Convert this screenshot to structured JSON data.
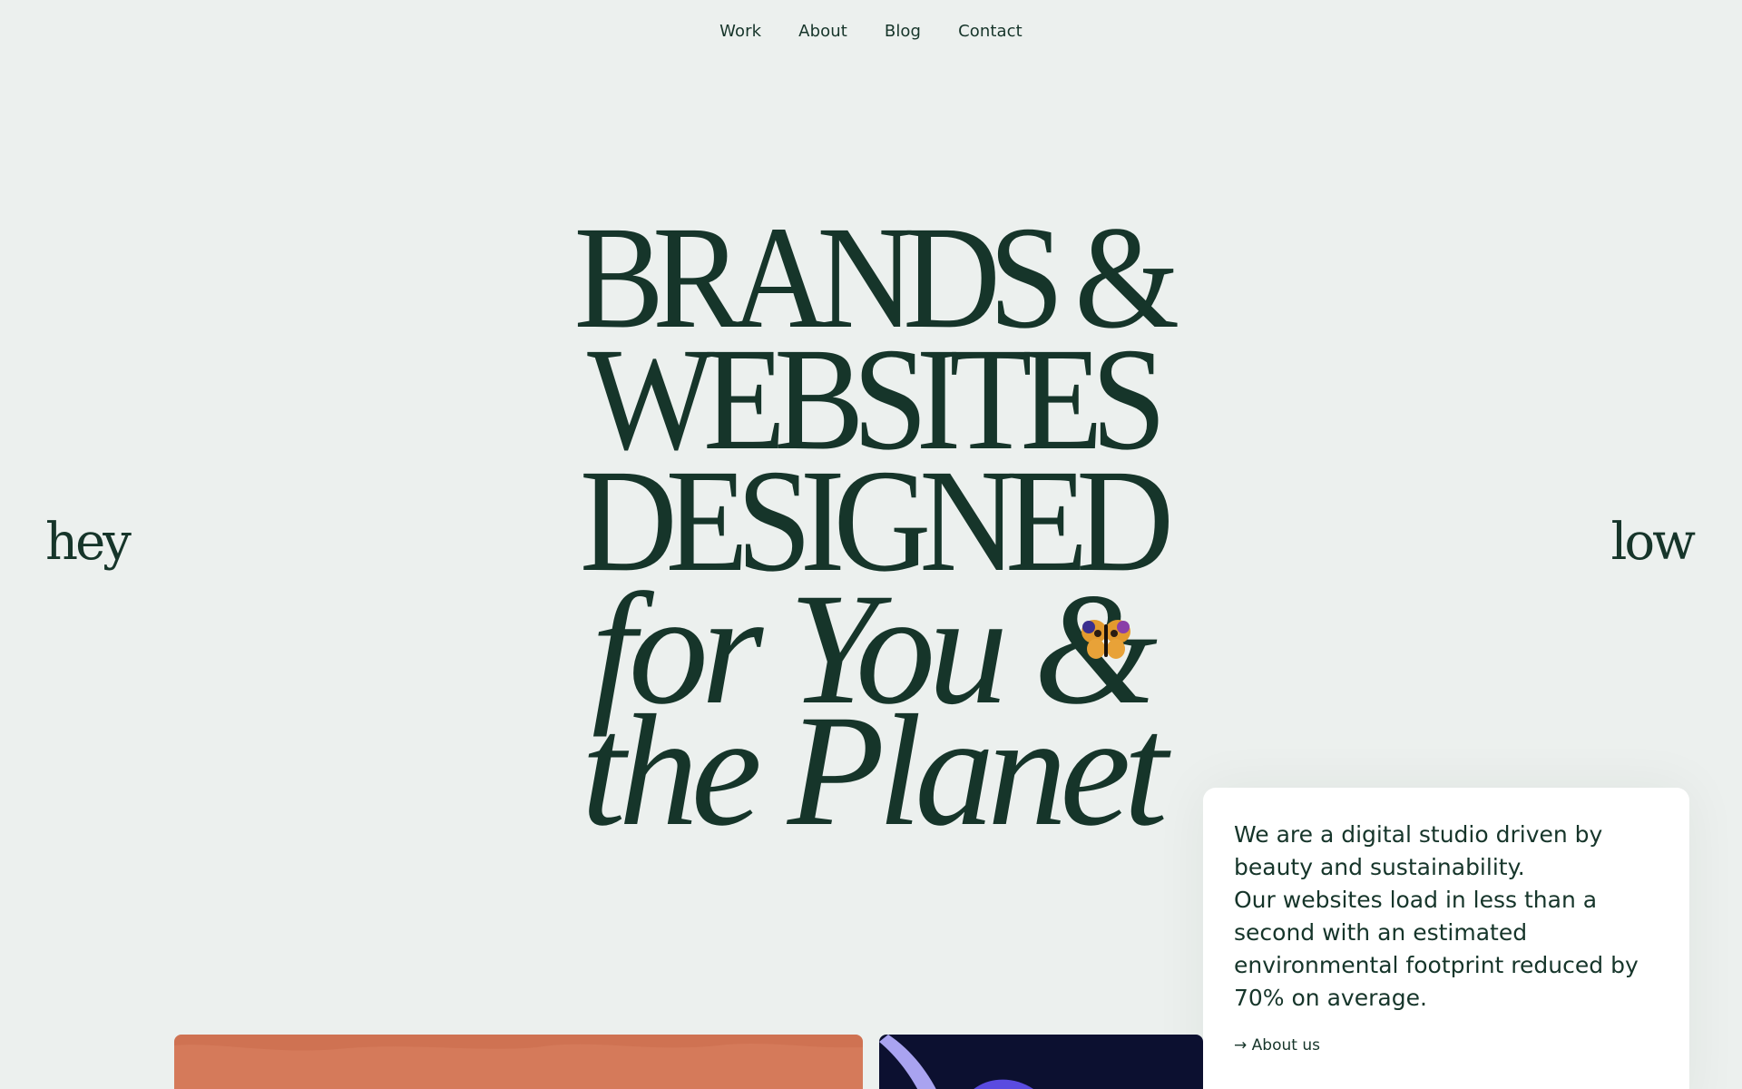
{
  "nav": {
    "items": [
      {
        "label": "Work"
      },
      {
        "label": "About"
      },
      {
        "label": "Blog"
      },
      {
        "label": "Contact"
      }
    ]
  },
  "side": {
    "left": "hey",
    "right": "low"
  },
  "hero": {
    "line1": "BRANDS &",
    "line2": "WEBSITES",
    "line3": "DESIGNED",
    "line4": "for You &",
    "line5": "the Planet"
  },
  "card": {
    "text_line1": "We are a digital studio driven by beauty and sustainability.",
    "text_line2": "Our websites load in less than a second with an estimated environmental footprint reduced by 70% on average.",
    "link_label": "→ About us"
  },
  "colors": {
    "background": "#ecf0ee",
    "ink": "#16352a",
    "card": "#ffffff",
    "thumb_orange": "#d57a5a",
    "thumb_navy": "#0c1030"
  }
}
